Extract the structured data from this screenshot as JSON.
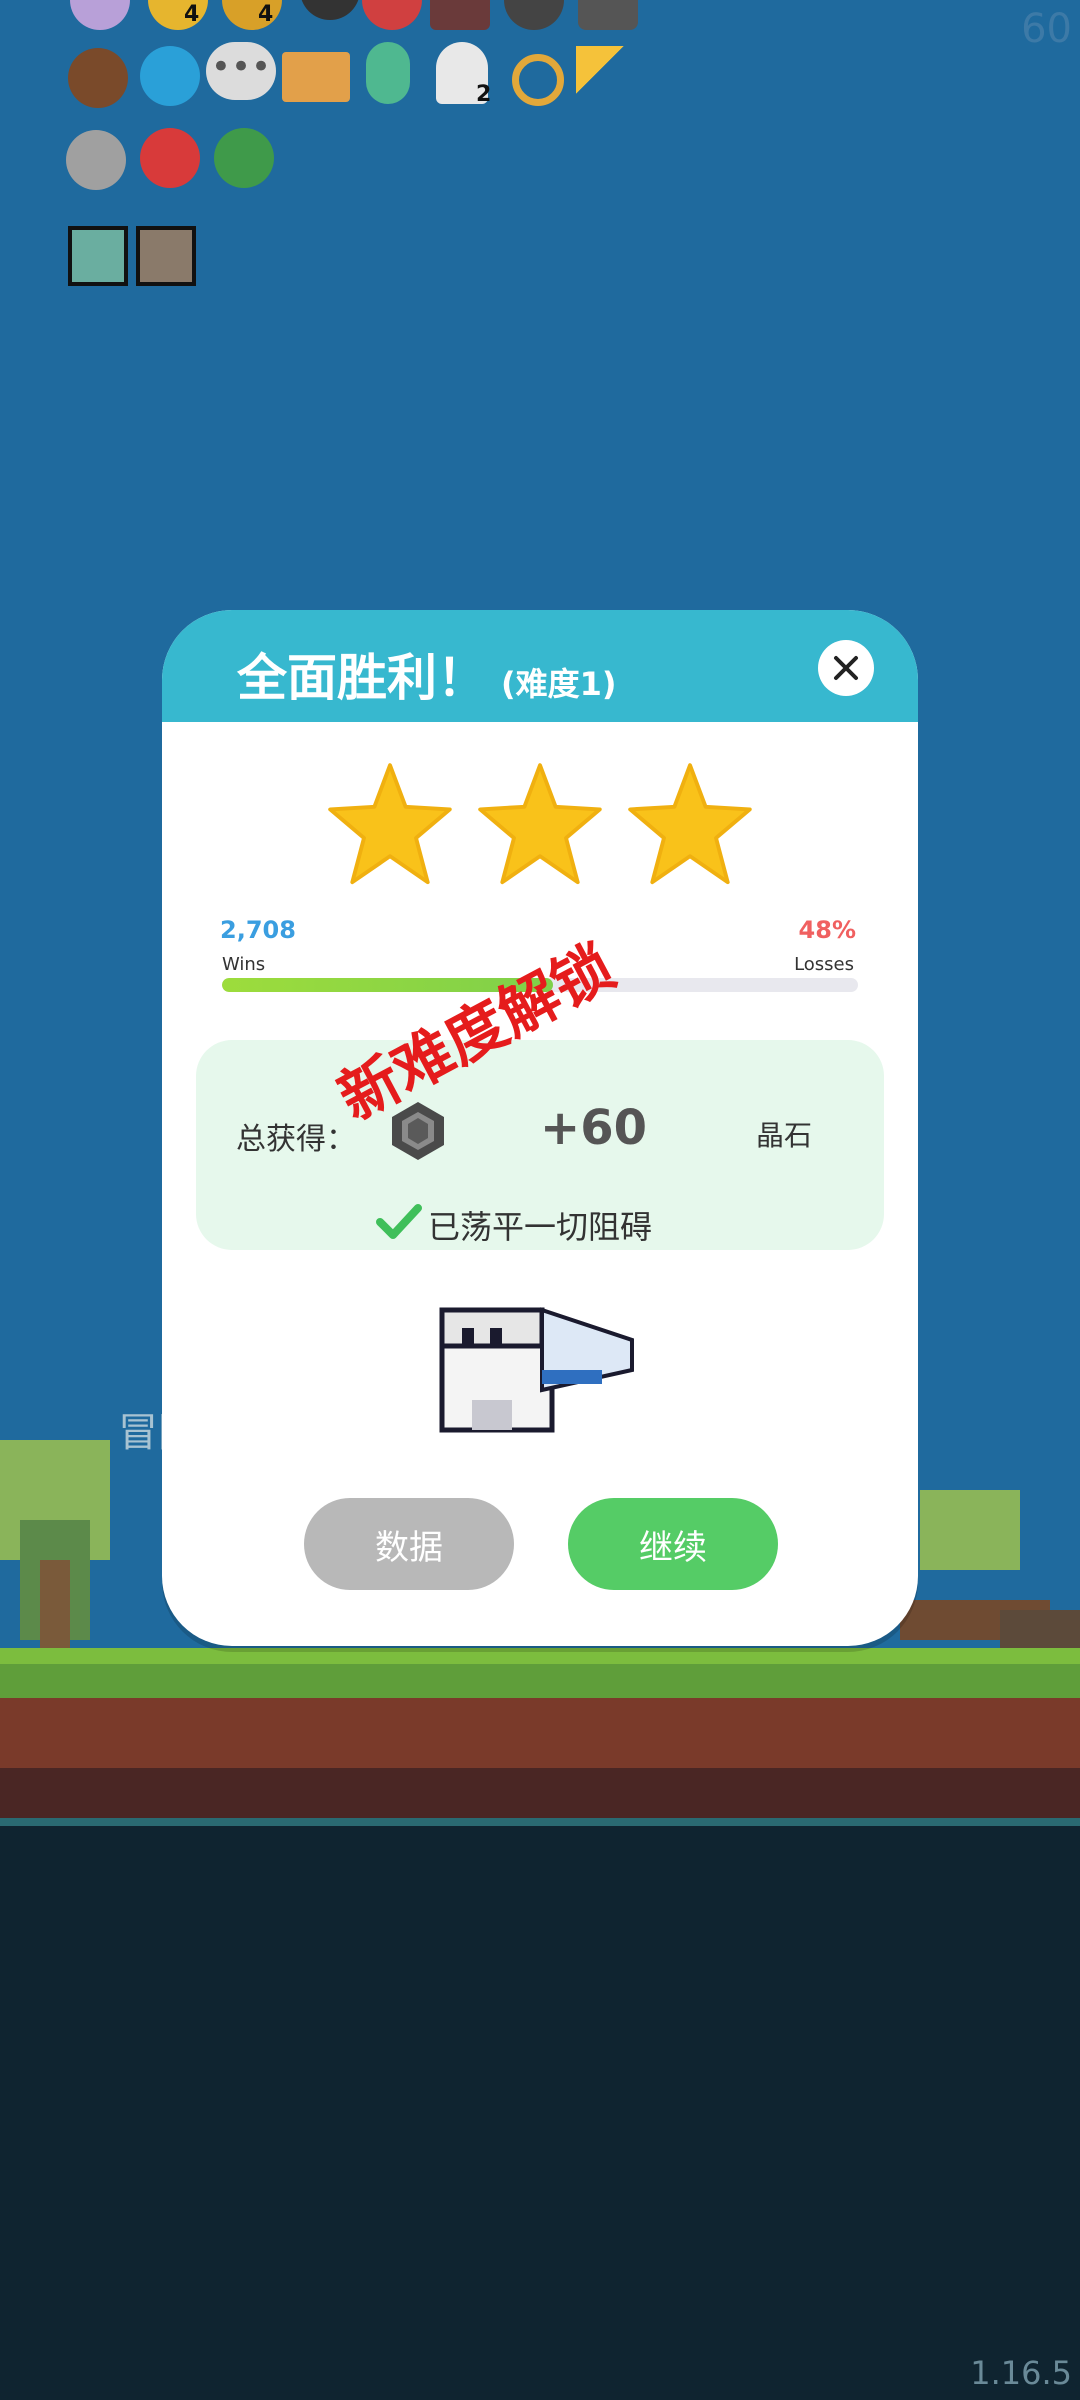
{
  "hud": {
    "fps": "60",
    "version": "1.16.5"
  },
  "inventory": {
    "badges": [
      "4",
      "4",
      "2"
    ],
    "icons": [
      "potion-icon",
      "gold-pile-icon",
      "coin-bag-icon",
      "bomb-icon",
      "ruby-icon",
      "chest-icon",
      "cauldron-icon",
      "helmet-icon",
      "coconut-icon",
      "chat-bubble-icon",
      "ellipsis-bubble-icon",
      "scroll-map-icon",
      "green-head-icon",
      "ghost-icon",
      "ring-icon",
      "magic-wand-icon",
      "meteor-icon",
      "mushroom-icon",
      "zombie-icon",
      "lightbulb-card-icon",
      "sword-card-icon"
    ]
  },
  "background": {
    "text_fragment": "冒险"
  },
  "dialog": {
    "title": "全面胜利！",
    "difficulty": "(难度1)",
    "stars": 3,
    "wins_value": "2,708",
    "wins_label": "Wins",
    "losses_value": "48%",
    "losses_label": "Losses",
    "win_fraction": 0.52,
    "stamp": "新难度解锁",
    "reward": {
      "total_label": "总获得：",
      "amount": "+60",
      "currency": "晶石"
    },
    "status": "已荡平一切阻碍",
    "buttons": {
      "stats": "数据",
      "continue": "继续"
    }
  },
  "colors": {
    "header": "#37b8cf",
    "continue": "#55cc66",
    "stats": "#b8b8b8",
    "stamp": "#e51c1c"
  }
}
